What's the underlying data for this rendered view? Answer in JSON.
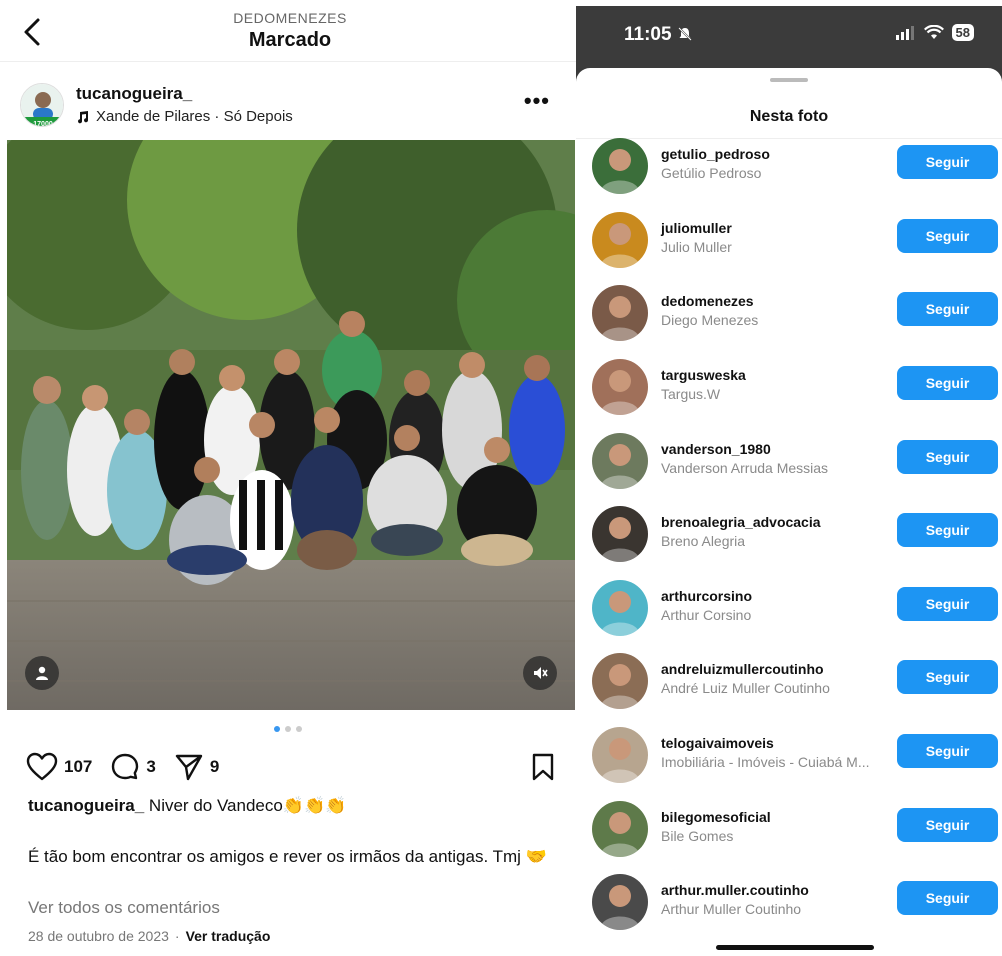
{
  "left": {
    "header": {
      "subtitle": "DEDOMENEZES",
      "title": "Marcado"
    },
    "post": {
      "username": "tucanogueira_",
      "music": "Xande de Pilares · Só Depois",
      "more": "•••",
      "avatar_badge": "17000"
    },
    "actions": {
      "likes": "107",
      "comments": "3",
      "shares": "9"
    },
    "caption": {
      "username": "tucanogueira_",
      "text": " Niver do Vandeco👏👏👏",
      "body": "É tão bom encontrar os amigos e rever os irmãos da antigas. Tmj 🤝"
    },
    "view_comments": "Ver todos os comentários",
    "date": "28 de outubro de 2023",
    "translate": "Ver tradução",
    "dots": {
      "count": 3,
      "active": 0
    }
  },
  "right": {
    "status": {
      "time": "11:05",
      "battery": "58"
    },
    "sheet_title": "Nesta foto",
    "follow_label": "Seguir",
    "people": [
      {
        "username": "getulio_pedroso",
        "name": "Getúlio Pedroso",
        "color": "#3b6e3a"
      },
      {
        "username": "juliomuller",
        "name": "Julio Muller",
        "color": "#c98a1e"
      },
      {
        "username": "dedomenezes",
        "name": "Diego Menezes",
        "color": "#7a5a48"
      },
      {
        "username": "targusweska",
        "name": "Targus.W",
        "color": "#a0705a"
      },
      {
        "username": "vanderson_1980",
        "name": "Vanderson Arruda Messias",
        "color": "#6d7a5e"
      },
      {
        "username": "brenoalegria_advocacia",
        "name": "Breno Alegria",
        "color": "#3a3530"
      },
      {
        "username": "arthurcorsino",
        "name": "Arthur Corsino",
        "color": "#4fb5c8"
      },
      {
        "username": "andreluizmullercoutinho",
        "name": "André Luiz Muller Coutinho",
        "color": "#8b6d55"
      },
      {
        "username": "telogaivaimoveis",
        "name": "Imobiliária - Imóveis - Cuiabá M...",
        "color": "#b7a58f"
      },
      {
        "username": "bilegomesoficial",
        "name": "Bile Gomes",
        "color": "#5e7a4a"
      },
      {
        "username": "arthur.muller.coutinho",
        "name": "Arthur Muller Coutinho",
        "color": "#4a4a4a"
      }
    ]
  }
}
